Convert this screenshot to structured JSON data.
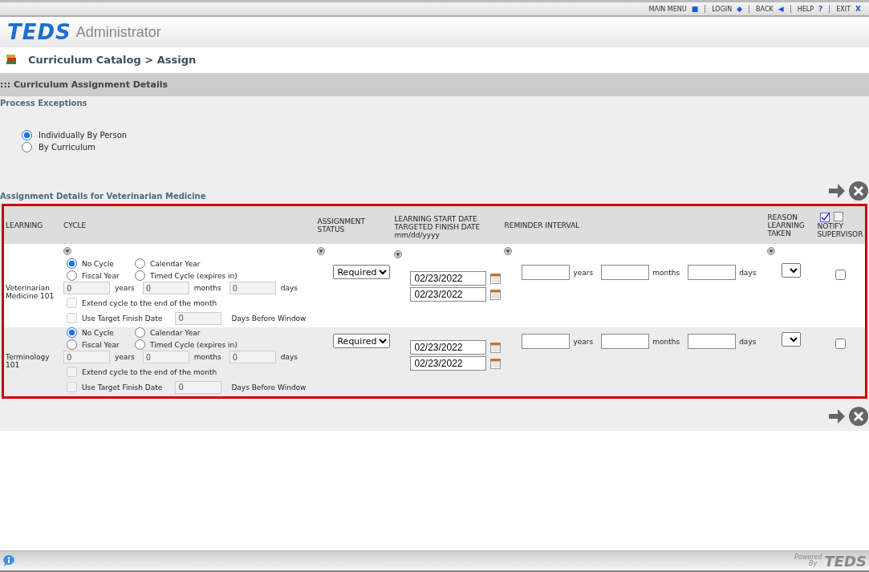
{
  "top_menu": [
    {
      "label": "MAIN MENU",
      "glyph": "■"
    },
    {
      "label": "LOGIN",
      "glyph": "◆"
    },
    {
      "label": "BACK",
      "glyph": "◀"
    },
    {
      "label": "HELP",
      "glyph": "?"
    },
    {
      "label": "EXIT",
      "glyph": "X"
    }
  ],
  "header": {
    "logo": "TEDS",
    "product": "Administrator"
  },
  "breadcrumb": "Curriculum Catalog > Assign",
  "section_title": "::: Curriculum Assignment Details",
  "process_exceptions": {
    "title": "Process Exceptions",
    "options": [
      {
        "label": "Individually By Person",
        "selected": true
      },
      {
        "label": "By Curriculum",
        "selected": false
      }
    ]
  },
  "details_title": "Assignment Details for Veterinarian Medicine",
  "table": {
    "columns": [
      {
        "label": "LEARNING",
        "sortable": false
      },
      {
        "label": "CYCLE",
        "sortable": true
      },
      {
        "label": "ASSIGNMENT STATUS",
        "sortable": true
      },
      {
        "label": "LEARNING START DATE TARGETED FINISH DATE mm/dd/yyyy",
        "sortable": true
      },
      {
        "label": "REMINDER INTERVAL",
        "sortable": true
      },
      {
        "label": "REASON LEARNING TAKEN",
        "sortable": true
      },
      {
        "label": "NOTIFY SUPERVISOR",
        "sortable": false
      }
    ],
    "rows": [
      {
        "learning": "Veterinarian Medicine 101",
        "cycle_options": [
          {
            "label": "No Cycle",
            "selected": true
          },
          {
            "label": "Calendar Year",
            "selected": false
          },
          {
            "label": "Fiscal Year",
            "selected": false
          },
          {
            "label": "Timed Cycle (expires in)",
            "selected": false
          }
        ],
        "cycle_fields": [
          {
            "value": "0",
            "unit": "years"
          },
          {
            "value": "0",
            "unit": "months"
          },
          {
            "value": "0",
            "unit": "days"
          }
        ],
        "cycle_fields_disabled": true,
        "extend": {
          "label": "Extend cycle to the end of the month",
          "checked": false,
          "disabled": true
        },
        "use_target": {
          "label": "Use Target Finish Date",
          "checked": false,
          "disabled": true,
          "value": "0",
          "suffix": "Days Before Window"
        },
        "status": "Required",
        "start_date": "02/23/2022",
        "finish_date": "02/23/2022",
        "reminder": [
          {
            "unit": "years"
          },
          {
            "unit": "months"
          },
          {
            "unit": "days"
          }
        ],
        "notify": false
      },
      {
        "learning": "Terminology 101",
        "cycle_options": [
          {
            "label": "No Cycle",
            "selected": true
          },
          {
            "label": "Calendar Year",
            "selected": false
          },
          {
            "label": "Fiscal Year",
            "selected": false
          },
          {
            "label": "Timed Cycle (expires in)",
            "selected": false
          }
        ],
        "cycle_fields": [
          {
            "value": "0",
            "unit": "years"
          },
          {
            "value": "0",
            "unit": "months"
          },
          {
            "value": "0",
            "unit": "days"
          }
        ],
        "cycle_fields_disabled": true,
        "extend": {
          "label": "Extend cycle to the end of the month",
          "checked": false,
          "disabled": true
        },
        "use_target": {
          "label": "Use Target Finish Date",
          "checked": false,
          "disabled": true,
          "value": "0",
          "suffix": "Days Before Window"
        },
        "status": "Required",
        "start_date": "02/23/2022",
        "finish_date": "02/23/2022",
        "reminder": [
          {
            "unit": "years"
          },
          {
            "unit": "months"
          },
          {
            "unit": "days"
          }
        ],
        "notify": false
      }
    ]
  },
  "footer": {
    "powered": "Powered",
    "by": "By",
    "logo": "TEDS"
  }
}
